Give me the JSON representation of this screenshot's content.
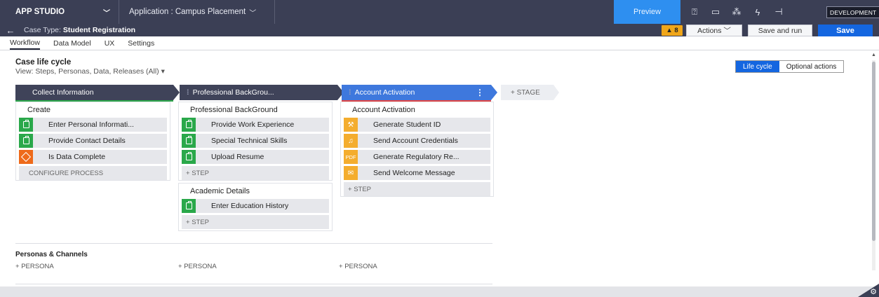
{
  "topbar": {
    "brand": "APP STUDIO",
    "application_label": "Application : Campus Placement",
    "preview_label": "Preview",
    "env_badge": "DEVELOPMENT",
    "icons": [
      "help-icon",
      "chat-icon",
      "spinner-icon",
      "flash-icon",
      "settings-tree-icon"
    ]
  },
  "casebar": {
    "case_type_prefix": "Case Type:",
    "case_type": "Student Registration",
    "warning_count": "8",
    "actions_label": "Actions",
    "save_run_label": "Save and run",
    "save_label": "Save"
  },
  "tabs": [
    "Workflow",
    "Data Model",
    "UX",
    "Settings"
  ],
  "active_tab": "Workflow",
  "lifecycle": {
    "title": "Case life cycle",
    "view_label": "View: Steps, Personas, Data, Releases (All)",
    "view_suffix": "▾",
    "toggle": [
      "Life cycle",
      "Optional actions"
    ],
    "add_stage_label": "STAGE"
  },
  "stages": [
    {
      "name": "Collect Information",
      "processes": [
        {
          "name": "Create",
          "steps": [
            {
              "label": "Enter Personal Informati...",
              "icon": "clipboard-icon",
              "color": "#2aa84a"
            },
            {
              "label": "Provide Contact Details",
              "icon": "clipboard-icon",
              "color": "#2aa84a"
            },
            {
              "label": "Is Data Complete",
              "icon": "decision-icon",
              "color": "#ee6a1a"
            }
          ],
          "footer": "CONFIGURE PROCESS"
        }
      ]
    },
    {
      "name": "Professional BackGrou...",
      "processes": [
        {
          "name": "Professional BackGround",
          "steps": [
            {
              "label": "Provide Work Experience",
              "icon": "clipboard-icon",
              "color": "#2aa84a"
            },
            {
              "label": "Special Technical Skills",
              "icon": "clipboard-icon",
              "color": "#2aa84a"
            },
            {
              "label": "Upload Resume",
              "icon": "clipboard-icon",
              "color": "#2aa84a"
            }
          ],
          "footer": "STEP"
        },
        {
          "name": "Academic Details",
          "steps": [
            {
              "label": "Enter Education History",
              "icon": "clipboard-icon",
              "color": "#2aa84a"
            }
          ],
          "footer": "STEP"
        }
      ]
    },
    {
      "name": "Account Activation",
      "processes": [
        {
          "name": "Account Activation",
          "steps": [
            {
              "label": "Generate Student ID",
              "icon": "wrench-icon",
              "color": "#f4ad2e"
            },
            {
              "label": "Send Account Credentials",
              "icon": "bell-icon",
              "color": "#f4ad2e"
            },
            {
              "label": "Generate Regulatory Re...",
              "icon": "pdf-icon",
              "color": "#f4ad2e",
              "icon_text": "PDF"
            },
            {
              "label": "Send Welcome Message",
              "icon": "mail-icon",
              "color": "#f4ad2e"
            }
          ],
          "footer": "STEP"
        }
      ]
    }
  ],
  "personas": {
    "title": "Personas & Channels",
    "add_label": "PERSONA"
  },
  "colors": {
    "header_bg": "#3b3f55",
    "primary": "#1466e0",
    "active_stage": "#3e78dd",
    "step_green": "#2aa84a",
    "step_orange": "#ee6a1a",
    "step_yellow": "#f4ad2e",
    "warning": "#f0a619"
  }
}
